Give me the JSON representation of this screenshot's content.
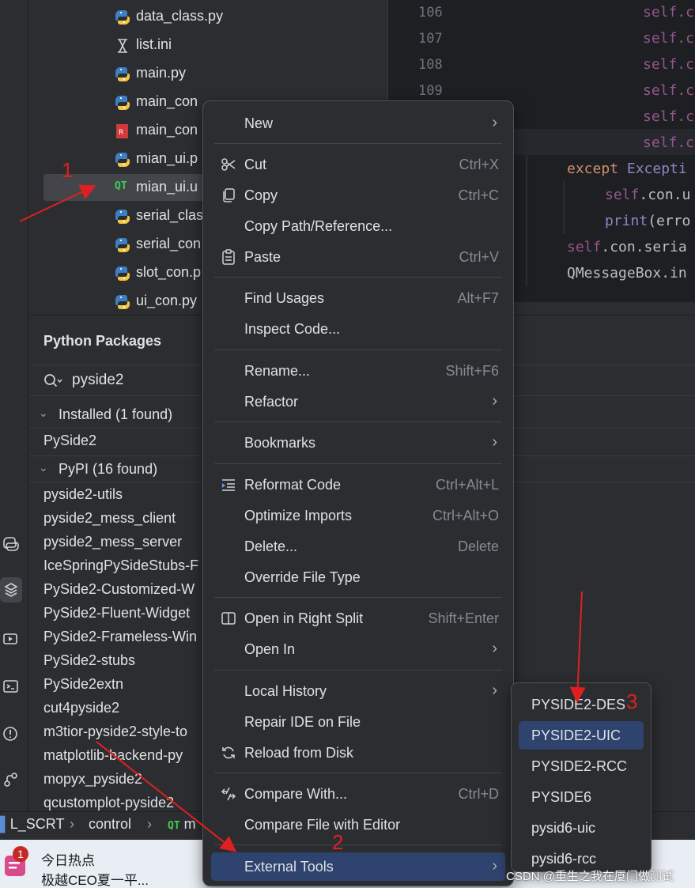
{
  "file_tree": {
    "files": [
      {
        "name": "data_class.py",
        "icon": "python-file-icon"
      },
      {
        "name": "list.ini",
        "icon": "ini-file-icon"
      },
      {
        "name": "main.py",
        "icon": "python-file-icon"
      },
      {
        "name": "main_con",
        "icon": "python-file-icon"
      },
      {
        "name": "main_con",
        "icon": "resource-file-icon"
      },
      {
        "name": "mian_ui.p",
        "icon": "python-file-icon"
      },
      {
        "name": "mian_ui.u",
        "icon": "qt-ui-file-icon",
        "selected": true
      },
      {
        "name": "serial_clas",
        "icon": "python-file-icon"
      },
      {
        "name": "serial_con",
        "icon": "python-file-icon"
      },
      {
        "name": "slot_con.p",
        "icon": "python-file-icon"
      },
      {
        "name": "ui_con.py",
        "icon": "python-file-icon"
      }
    ],
    "qt_label": "QT"
  },
  "editor": {
    "line_numbers": [
      "106",
      "107",
      "108",
      "109"
    ],
    "lines": {
      "l1": "self.c",
      "l2": "self.c",
      "l3": "self.c",
      "l4": "self.c",
      "l5": "self.c",
      "l6": "self.c",
      "except_kw": "except",
      "except_cls": "Excepti",
      "l8_self": "self",
      "l8_rest": ".con.u",
      "l9_fn": "print",
      "l9_rest": "(erro",
      "l10_self": "self",
      "l10_rest": ".con.seria",
      "l11": "QMessageBox.in"
    }
  },
  "packages": {
    "title": "Python Packages",
    "search_value": "pyside2",
    "installed_group": "Installed (1 found)",
    "installed": [
      "PySide2"
    ],
    "pypi_group": "PyPI (16 found)",
    "pypi": [
      "pyside2-utils",
      "pyside2_mess_client",
      "pyside2_mess_server",
      "IceSpringPySideStubs-F",
      "PySide2-Customized-W",
      "PySide2-Fluent-Widget",
      "PySide2-Frameless-Win",
      "PySide2-stubs",
      "PySide2extn",
      "cut4pyside2",
      "m3tior-pyside2-style-to",
      "matplotlib-backend-py",
      "mopyx_pyside2",
      "qcustomplot-pyside2"
    ]
  },
  "statusbar": {
    "crumbs": [
      "L_SCRT",
      "control",
      "m"
    ],
    "qt_label": "QT"
  },
  "context_menu": {
    "items": [
      {
        "label": "New",
        "shortcut": "",
        "submenu": true
      },
      {
        "label": "Cut",
        "shortcut": "Ctrl+X",
        "icon": "scissors-icon"
      },
      {
        "label": "Copy",
        "shortcut": "Ctrl+C",
        "icon": "copy-icon"
      },
      {
        "label": "Copy Path/Reference...",
        "shortcut": ""
      },
      {
        "label": "Paste",
        "shortcut": "Ctrl+V",
        "icon": "clipboard-icon"
      },
      {
        "label": "Find Usages",
        "shortcut": "Alt+F7"
      },
      {
        "label": "Inspect Code...",
        "shortcut": ""
      },
      {
        "label": "Rename...",
        "shortcut": "Shift+F6"
      },
      {
        "label": "Refactor",
        "shortcut": "",
        "submenu": true
      },
      {
        "label": "Bookmarks",
        "shortcut": "",
        "submenu": true
      },
      {
        "label": "Reformat Code",
        "shortcut": "Ctrl+Alt+L",
        "icon": "reformat-icon"
      },
      {
        "label": "Optimize Imports",
        "shortcut": "Ctrl+Alt+O"
      },
      {
        "label": "Delete...",
        "shortcut": "Delete"
      },
      {
        "label": "Override File Type",
        "shortcut": ""
      },
      {
        "label": "Open in Right Split",
        "shortcut": "Shift+Enter",
        "icon": "split-icon"
      },
      {
        "label": "Open In",
        "shortcut": "",
        "submenu": true
      },
      {
        "label": "Local History",
        "shortcut": "",
        "submenu": true
      },
      {
        "label": "Repair IDE on File",
        "shortcut": ""
      },
      {
        "label": "Reload from Disk",
        "shortcut": "",
        "icon": "reload-icon"
      },
      {
        "label": "Compare With...",
        "shortcut": "Ctrl+D",
        "icon": "compare-icon"
      },
      {
        "label": "Compare File with Editor",
        "shortcut": ""
      },
      {
        "label": "External Tools",
        "shortcut": "",
        "submenu": true,
        "highlighted": true
      }
    ]
  },
  "submenu": {
    "items": [
      {
        "label": "PYSIDE2-DES"
      },
      {
        "label": "PYSIDE2-UIC",
        "highlighted": true
      },
      {
        "label": "PYSIDE2-RCC"
      },
      {
        "label": "PYSIDE6"
      },
      {
        "label": "pysid6-uic"
      },
      {
        "label": "pysid6-rcc"
      }
    ]
  },
  "annotations": {
    "n1": "1",
    "n2": "2",
    "n3": "3"
  },
  "taskbar": {
    "badge_count": "1",
    "news_title": "今日热点",
    "news_sub": "极越CEO夏一平...",
    "watermark": "CSDN @重生之我在厦门做测试"
  },
  "colors": {
    "background": "#2b2d30",
    "editor_bg": "#1e1f22",
    "highlight": "#2e436e",
    "annotation": "#e02020"
  }
}
